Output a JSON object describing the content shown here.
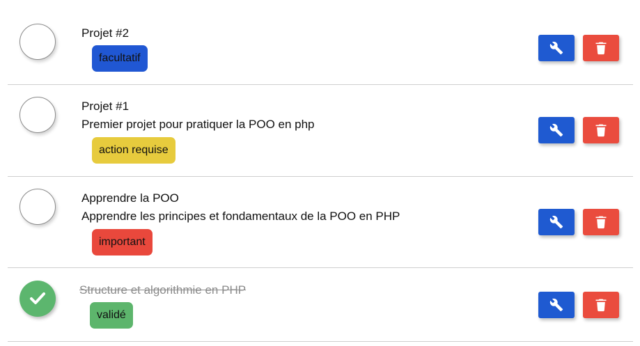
{
  "colors": {
    "edit_button": "#1f5ad1",
    "delete_button": "#ea4c3e",
    "done_check": "#5cb66e"
  },
  "tasks": [
    {
      "title": "Projet #2",
      "description": "",
      "tag": {
        "label": "facultatif",
        "color": "#2057d3"
      },
      "done": false,
      "edit_icon": "wrench-icon",
      "delete_icon": "trash-icon"
    },
    {
      "title": "Projet #1",
      "description": "Premier projet pour pratiquer la POO en php",
      "tag": {
        "label": "action requise",
        "color": "#e7cb3d"
      },
      "done": false,
      "edit_icon": "wrench-icon",
      "delete_icon": "trash-icon"
    },
    {
      "title": "Apprendre la POO",
      "description": "Apprendre les principes et fondamentaux de la POO en PHP",
      "tag": {
        "label": "important",
        "color": "#e9483c"
      },
      "done": false,
      "edit_icon": "wrench-icon",
      "delete_icon": "trash-icon"
    },
    {
      "title": "Structure et algorithmie en PHP",
      "description": "",
      "tag": {
        "label": "validé",
        "color": "#5db56c"
      },
      "done": true,
      "edit_icon": "wrench-icon",
      "delete_icon": "trash-icon"
    }
  ]
}
